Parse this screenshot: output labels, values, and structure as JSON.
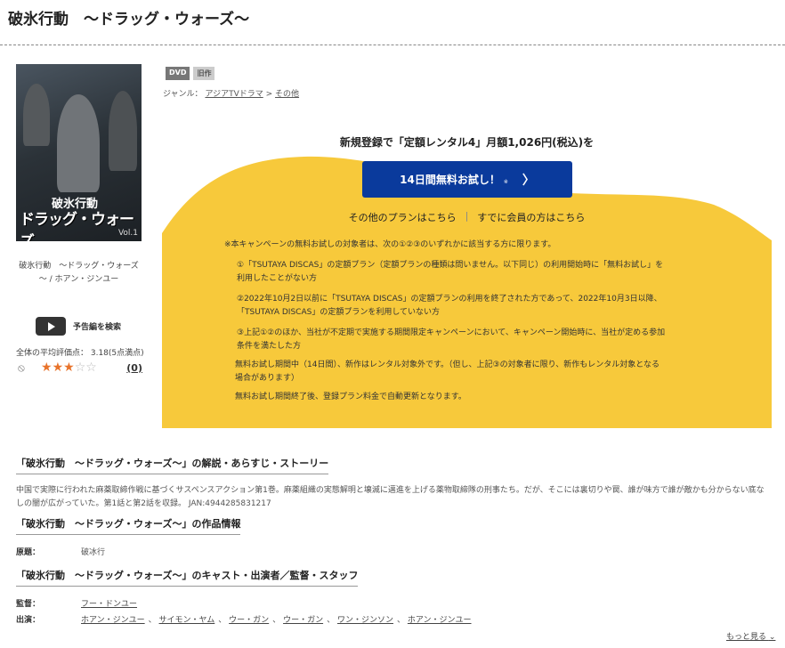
{
  "page": {
    "title": "破氷行動　～ドラッグ・ウォーズ～"
  },
  "cover": {
    "title_small": "破氷行動",
    "title_large": "ドラッグ・ウォーズ",
    "vol": "Vol.1",
    "caption_line1": "破氷行動　～ドラッグ・ウォーズ",
    "caption_line2": "～ / ホアン・ジンユー"
  },
  "trailer": {
    "label": "予告編を検索"
  },
  "rating": {
    "average_text": "全体の平均評価点：  3.18(5点満点)",
    "stars": 3,
    "max": 5,
    "count": "(0)"
  },
  "badges": {
    "format": "DVD",
    "status": "旧作"
  },
  "genre": {
    "label": "ジャンル：",
    "crumb1": "アジアTVドラマ",
    "sep": ">",
    "crumb2": "その他"
  },
  "promo": {
    "headline": "新規登録で「定額レンタル4」月額1,026円(税込)を",
    "button_label": "14日間無料お試し！",
    "button_note": "※",
    "button_chevron": "〉",
    "other_plans": "その他のプランはこちら",
    "separator": "|",
    "members": "すでに会員の方はこちら",
    "bg_color": "#f7c93b",
    "button_color": "#0a3a9c"
  },
  "notes": {
    "intro": "※本キャンペーンの無料お試しの対象者は、次の①②③のいずれかに該当する方に限ります。",
    "n1_l1": "①「TSUTAYA DISCAS」の定額プラン（定額プランの種類は問いません。以下同じ）の利用開始時に「無料お試し」を",
    "n1_l2": "利用したことがない方",
    "n2_l1": "②2022年10月2日以前に「TSUTAYA DISCAS」の定額プランの利用を終了された方であって、2022年10月3日以降、",
    "n2_l2": "「TSUTAYA DISCAS」の定額プランを利用していない方",
    "n3_l1": "③上記①②のほか、当社が不定期で実施する期間限定キャンペーンにおいて、キャンペーン開始時に、当社が定める参加",
    "n3_l2": "条件を満たした方",
    "trial_l1": "無料お試し期間中（14日間）、新作はレンタル対象外です。（但し、上記③の対象者に限り、新作もレンタル対象となる",
    "trial_l2": "場合があります）",
    "after": "無料お試し期間終了後、登録プラン料金で自動更新となります。"
  },
  "sections": {
    "story_title": "「破氷行動　～ドラッグ・ウォーズ～」の解説・あらすじ・ストーリー",
    "story_l1": "中国で実際に行われた麻薬取締作戦に基づくサスペンスアクション第1巻。麻薬組織の実態解明と壊滅に邁進を上げる薬物取締隊の刑事たち。だが、そこには裏切りや罠、誰が味方で誰が敵かも分からない底な",
    "story_l2": "しの闇が広がっていた。第1話と第2話を収録。 JAN:4944285831217",
    "info_title": "「破氷行動　～ドラッグ・ウォーズ～」の作品情報",
    "orig_label": "原題：",
    "orig_value": "破冰行",
    "cast_title": "「破氷行動　～ドラッグ・ウォーズ～」のキャスト・出演者／監督・スタッフ",
    "director_label": "監督：",
    "director": "フー・ドンユー",
    "cast_label": "出演：",
    "cast": [
      "ホアン・ジンユー",
      "サイモン・ヤム",
      "ウー・ガン",
      "ウー・ガン",
      "ワン・ジンソン",
      "ホアン・ジンユー"
    ],
    "comma": "、",
    "more": "もっと見る"
  }
}
